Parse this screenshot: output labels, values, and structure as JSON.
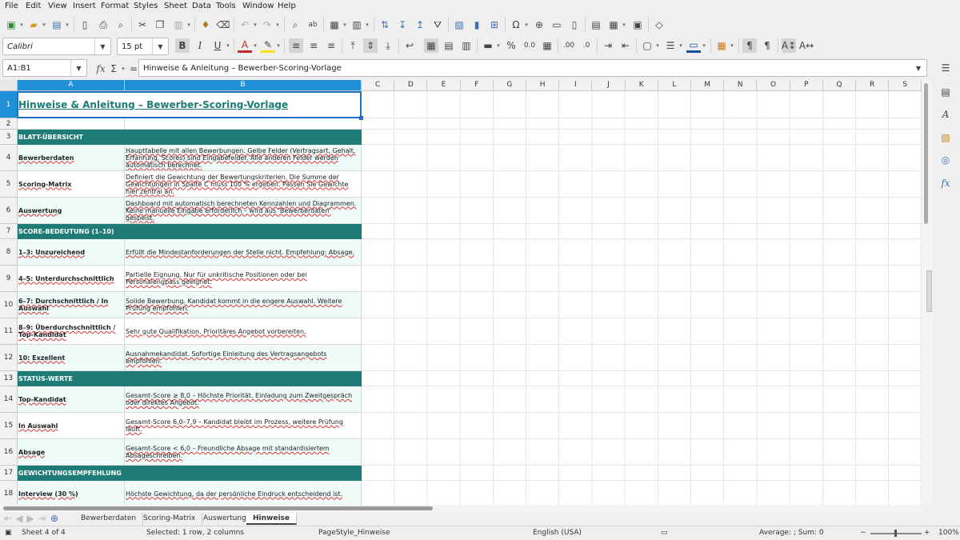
{
  "menu": [
    "File",
    "Edit",
    "View",
    "Insert",
    "Format",
    "Styles",
    "Sheet",
    "Data",
    "Tools",
    "Window",
    "Help"
  ],
  "formatting": {
    "font_name": "Calibri",
    "font_size": "15 pt"
  },
  "formula_bar": {
    "name_box": "A1:B1",
    "content": "Hinweise & Anleitung – Bewerber-Scoring-Vorlage"
  },
  "columns": [
    "A",
    "B",
    "C",
    "D",
    "E",
    "F",
    "G",
    "H",
    "I",
    "J",
    "K",
    "L",
    "M",
    "N",
    "O",
    "P",
    "Q",
    "R",
    "S"
  ],
  "rows": [
    {
      "n": "1",
      "type": "title",
      "a": "Hinweise & Anleitung – Bewerber-Scoring-Vorlage",
      "b": ""
    },
    {
      "n": "2",
      "type": "blank",
      "a": "",
      "b": ""
    },
    {
      "n": "3",
      "type": "hdr",
      "a": "BLATT-ÜBERSICHT",
      "b": ""
    },
    {
      "n": "4",
      "type": "alt",
      "a": "Bewerberdaten",
      "b": "Haupttabelle mit allen Bewerbungen. Gelbe Felder (Vertragsart, Gehalt, Erfahrung, Scores) sind Eingabefelder. Alle anderen Felder werden automatisch berechnet."
    },
    {
      "n": "5",
      "type": "plain",
      "a": "Scoring-Matrix",
      "b": "Definiert die Gewichtung der Bewertungskriterien. Die Summe der Gewichtungen in Spalte C muss 100 % ergeben. Passen Sie Gewichte hier zentral an."
    },
    {
      "n": "6",
      "type": "alt",
      "a": "Auswertung",
      "b": "Dashboard mit automatisch berechneten Kennzahlen und Diagrammen. Keine manuelle Eingabe erforderlich – wird aus 'Bewerberdaten' gespeist."
    },
    {
      "n": "7",
      "type": "hdr",
      "a": "SCORE-BEDEUTUNG (1–10)",
      "b": ""
    },
    {
      "n": "8",
      "type": "alt",
      "a": "1–3: Unzureichend",
      "b": "Erfüllt die Mindestanforderungen der Stelle nicht. Empfehlung: Absage."
    },
    {
      "n": "9",
      "type": "plain",
      "a": "4–5: Unterdurchschnittlich",
      "b": "Partielle Eignung. Nur für unkritische Positionen oder bei Personalengpass geeignet."
    },
    {
      "n": "10",
      "type": "alt",
      "a": "6–7: Durchschnittlich / In Auswahl",
      "b": "Solide Bewerbung. Kandidat kommt in die engere Auswahl. Weitere Prüfung empfohlen."
    },
    {
      "n": "11",
      "type": "plain",
      "a": "8–9: Überdurchschnittlich / Top-Kandidat",
      "b": "Sehr gute Qualifikation. Prioritäres Angebot vorbereiten."
    },
    {
      "n": "12",
      "type": "alt",
      "a": "10: Exzellent",
      "b": "Ausnahmekandidat. Sofortige Einleitung des Vertragsangebots empfohlen."
    },
    {
      "n": "13",
      "type": "hdr",
      "a": "STATUS-WERTE",
      "b": ""
    },
    {
      "n": "14",
      "type": "alt",
      "a": "Top-Kandidat",
      "b": "Gesamt-Score ≥ 8,0 – Höchste Priorität. Einladung zum Zweitgespräch oder direktes Angebot."
    },
    {
      "n": "15",
      "type": "plain",
      "a": "In Auswahl",
      "b": "Gesamt-Score 6,0–7,9 – Kandidat bleibt im Prozess, weitere Prüfung läuft."
    },
    {
      "n": "16",
      "type": "alt",
      "a": "Absage",
      "b": "Gesamt-Score < 6,0 – Freundliche Absage mit standardisiertem Absageschreiben."
    },
    {
      "n": "17",
      "type": "hdr",
      "a": "GEWICHTUNGSEMPFEHLUNG",
      "b": ""
    },
    {
      "n": "18",
      "type": "alt",
      "a": "Interview (30 %)",
      "b": "Höchste Gewichtung, da der persönliche Eindruck entscheidend ist."
    }
  ],
  "sheet_tabs": [
    "Bewerberdaten",
    "Scoring-Matrix",
    "Auswertung",
    "Hinweise"
  ],
  "active_tab": "Hinweise",
  "status": {
    "sheet": "Sheet 4 of 4",
    "selection": "Selected: 1 row, 2 columns",
    "page_style": "PageStyle_Hinweise",
    "language": "English (USA)",
    "summary": "Average: ; Sum: 0",
    "zoom": "100%"
  },
  "colors": {
    "header_teal": "#1e7b75",
    "alt_row": "#eefbf9",
    "selection_blue": "#1f8fd8"
  }
}
